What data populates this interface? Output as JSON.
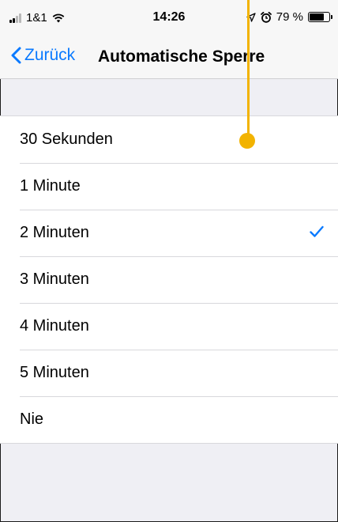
{
  "status_bar": {
    "carrier": "1&1",
    "time": "14:26",
    "battery_text": "79 %",
    "battery_level": 0.79,
    "icons": [
      "signal-icon",
      "wifi-icon",
      "location-icon",
      "alarm-icon",
      "battery-icon"
    ]
  },
  "nav": {
    "back_label": "Zurück",
    "title": "Automatische Sperre"
  },
  "options": [
    {
      "label": "30 Sekunden",
      "selected": false
    },
    {
      "label": "1 Minute",
      "selected": false
    },
    {
      "label": "2 Minuten",
      "selected": true
    },
    {
      "label": "3 Minuten",
      "selected": false
    },
    {
      "label": "4 Minuten",
      "selected": false
    },
    {
      "label": "5 Minuten",
      "selected": false
    },
    {
      "label": "Nie",
      "selected": false
    }
  ],
  "colors": {
    "accent": "#0a7aff",
    "callout": "#f2b300",
    "background": "#efeff4"
  }
}
